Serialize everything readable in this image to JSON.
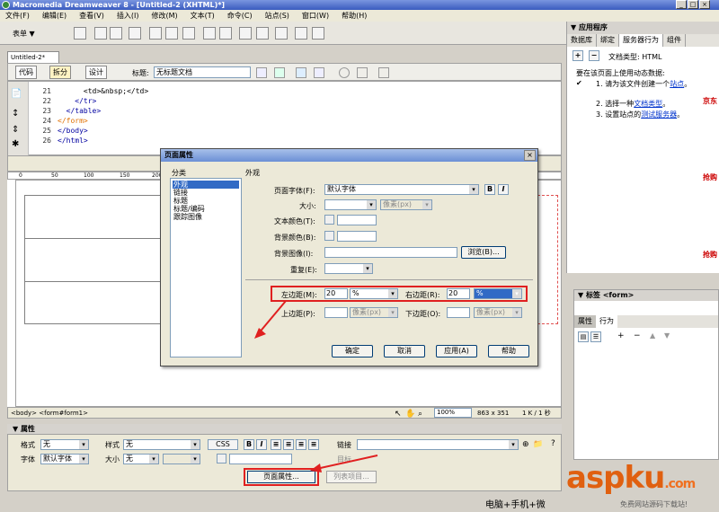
{
  "app": {
    "title": "Macromedia Dreamweaver 8 - [Untitled-2 (XHTML)*]",
    "min": "_",
    "restore": "□",
    "close": "×"
  },
  "menu": [
    "文件(F)",
    "编辑(E)",
    "查看(V)",
    "插入(I)",
    "修改(M)",
    "文本(T)",
    "命令(C)",
    "站点(S)",
    "窗口(W)",
    "帮助(H)"
  ],
  "insertbar": {
    "category": "表单 ▼"
  },
  "doc": {
    "tab": "Untitled-2*",
    "view_code": "代码",
    "view_split": "拆分",
    "view_design": "设计",
    "title_label": "标题:",
    "title_value": "无标题文档"
  },
  "code": {
    "lines": [
      {
        "n": "21",
        "text": "      <td>&nbsp;</td>"
      },
      {
        "n": "22",
        "text": "    </tr>"
      },
      {
        "n": "23",
        "text": "  </table>"
      },
      {
        "n": "24",
        "text": "</form>"
      },
      {
        "n": "25",
        "text": "</body>"
      },
      {
        "n": "26",
        "text": "</html>"
      }
    ]
  },
  "ruler": {
    "ticks": [
      "0",
      "50",
      "100",
      "150",
      "200"
    ]
  },
  "status": {
    "path": "<body> <form#form1>",
    "zoom": "100%",
    "size": "863 x 351",
    "speed": "1 K / 1 秒"
  },
  "properties": {
    "header": "▼ 属性",
    "format_label": "格式",
    "format_value": "无",
    "style_label": "样式",
    "style_value": "无",
    "css_label": "CSS",
    "link_label": "链接",
    "font_label": "字体",
    "font_value": "默认字体",
    "size_label": "大小",
    "size_value": "无",
    "target_label": "目标",
    "page_props_btn": "页面属性...",
    "list_item_btn": "列表项目..."
  },
  "rightpanel": {
    "header": "▼ 应用程序",
    "tabs": [
      "数据库",
      "绑定",
      "服务器行为",
      "组件"
    ],
    "doctype": "文档类型: HTML",
    "intro": "要在该页面上使用动态数据:",
    "steps": [
      {
        "n": "1.",
        "pre": "请为该文件创建一个",
        "link": "站点",
        "post": "。"
      },
      {
        "n": "2.",
        "pre": "选择一种",
        "link": "文档类型",
        "post": "。"
      },
      {
        "n": "3.",
        "pre": "设置站点的",
        "link": "测试服务器",
        "post": "。"
      }
    ]
  },
  "tagpanel": {
    "header": "▼ 标签 <form>",
    "tabs": [
      "属性",
      "行为"
    ]
  },
  "dialog": {
    "title": "页面属性",
    "close": "×",
    "category_label": "分类",
    "section_label": "外观",
    "categories": [
      "外观",
      "链接",
      "标题",
      "标题/编码",
      "跟踪图像"
    ],
    "page_font_label": "页面字体(F):",
    "page_font_value": "默认字体",
    "bold": "B",
    "italic": "I",
    "size_label": "大小:",
    "size_unit": "像素(px)",
    "text_color_label": "文本颜色(T):",
    "bg_color_label": "背景颜色(B):",
    "bg_image_label": "背景图像(I):",
    "browse_btn": "浏览(B)...",
    "repeat_label": "重复(E):",
    "left_margin_label": "左边距(M):",
    "left_margin_value": "20",
    "left_margin_unit": "%",
    "right_margin_label": "右边距(R):",
    "right_margin_value": "20",
    "right_margin_unit": "%",
    "top_margin_label": "上边距(P):",
    "top_margin_unit": "像素(px)",
    "bottom_margin_label": "下边距(O):",
    "bottom_margin_unit": "像素(px)",
    "ok_btn": "确定",
    "cancel_btn": "取消",
    "apply_btn": "应用(A)",
    "help_btn": "帮助"
  },
  "watermark": {
    "brand": "aspku",
    "suffix": ".com",
    "tagline": "免费网站源码下载站!"
  },
  "bottom_text": "电脑+手机+微",
  "side_ads": [
    "抢购",
    "抢购",
    "京东"
  ],
  "colors": {
    "annotation": "#e02020",
    "selection": "#316ac5",
    "link": "#0033cc"
  }
}
